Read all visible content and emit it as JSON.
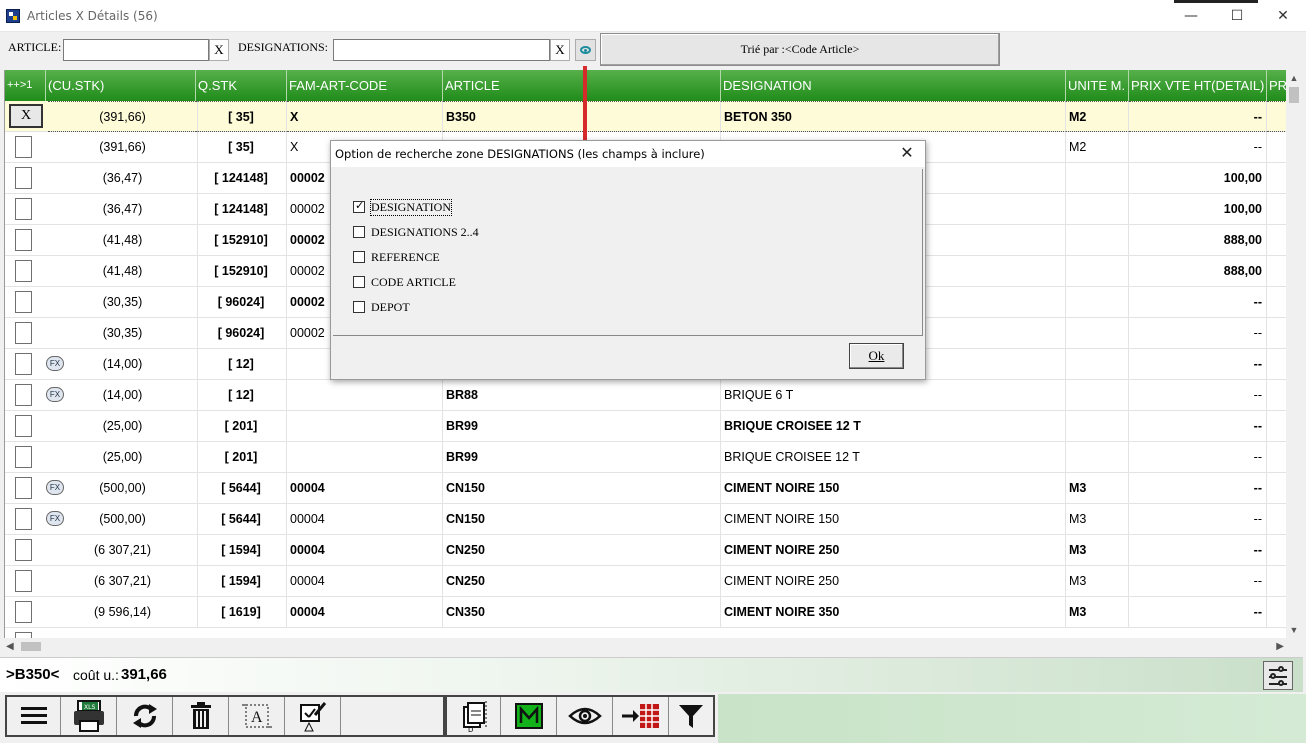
{
  "window": {
    "title": "Articles X Détails (56)"
  },
  "search": {
    "article_label": "ARTICLE:",
    "article_value": "",
    "article_clear": "X",
    "designations_label": "DESIGNATIONS:",
    "designations_value": "",
    "designations_clear": "X",
    "sort_label": "Trié par :<Code Article>"
  },
  "grid": {
    "headers": [
      "++>1",
      "(CU.STK)",
      "Q.STK",
      "FAM-ART-CODE",
      "ARTICLE",
      "DESIGNATION",
      "UNITE M.",
      "PRIX VTE HT(DETAIL)",
      "PR"
    ],
    "rows": [
      {
        "sel": "X",
        "fx": false,
        "cu": "(391,66)",
        "q": "[ 35]",
        "fam": "X",
        "art": "B350",
        "des": "BETON 350",
        "unit": "M2",
        "prix": "--",
        "b": true,
        "selected": true
      },
      {
        "sel": "",
        "fx": false,
        "cu": "(391,66)",
        "q": "[ 35]",
        "fam": "X",
        "art": "",
        "des": "",
        "unit": "M2",
        "prix": "--",
        "b": false
      },
      {
        "sel": "",
        "fx": false,
        "cu": "(36,47)",
        "q": "[ 124148]",
        "fam": "00002",
        "art": "",
        "des": "",
        "unit": "",
        "prix": "100,00",
        "b": true
      },
      {
        "sel": "",
        "fx": false,
        "cu": "(36,47)",
        "q": "[ 124148]",
        "fam": "00002",
        "art": "",
        "des": "",
        "unit": "",
        "prix": "100,00",
        "b": false,
        "pb": true
      },
      {
        "sel": "",
        "fx": false,
        "cu": "(41,48)",
        "q": "[ 152910]",
        "fam": "00002",
        "art": "",
        "des": "",
        "unit": "",
        "prix": "888,00",
        "b": true
      },
      {
        "sel": "",
        "fx": false,
        "cu": "(41,48)",
        "q": "[ 152910]",
        "fam": "00002",
        "art": "",
        "des": "",
        "unit": "",
        "prix": "888,00",
        "b": false,
        "pb": true
      },
      {
        "sel": "",
        "fx": false,
        "cu": "(30,35)",
        "q": "[ 96024]",
        "fam": "00002",
        "art": "",
        "des": "",
        "unit": "",
        "prix": "--",
        "b": true
      },
      {
        "sel": "",
        "fx": false,
        "cu": "(30,35)",
        "q": "[ 96024]",
        "fam": "00002",
        "art": "",
        "des": "",
        "unit": "",
        "prix": "--",
        "b": false
      },
      {
        "sel": "",
        "fx": true,
        "cu": "(14,00)",
        "q": "[ 12]",
        "fam": "",
        "art": "",
        "des": "",
        "unit": "",
        "prix": "--",
        "b": true
      },
      {
        "sel": "",
        "fx": true,
        "cu": "(14,00)",
        "q": "[ 12]",
        "fam": "",
        "art": "BR88",
        "des": "BRIQUE 6 T",
        "unit": "",
        "prix": "--",
        "b": false
      },
      {
        "sel": "",
        "fx": false,
        "cu": "(25,00)",
        "q": "[ 201]",
        "fam": "",
        "art": "BR99",
        "des": "BRIQUE CROISEE 12 T",
        "unit": "",
        "prix": "--",
        "b": true
      },
      {
        "sel": "",
        "fx": false,
        "cu": "(25,00)",
        "q": "[ 201]",
        "fam": "",
        "art": "BR99",
        "des": "BRIQUE CROISEE 12 T",
        "unit": "",
        "prix": "--",
        "b": false
      },
      {
        "sel": "",
        "fx": true,
        "cu": "(500,00)",
        "q": "[ 5644]",
        "fam": "00004",
        "art": "CN150",
        "des": "CIMENT NOIRE 150",
        "unit": "M3",
        "prix": "--",
        "b": true
      },
      {
        "sel": "",
        "fx": true,
        "cu": "(500,00)",
        "q": "[ 5644]",
        "fam": "00004",
        "art": "CN150",
        "des": "CIMENT NOIRE 150",
        "unit": "M3",
        "prix": "--",
        "b": false
      },
      {
        "sel": "",
        "fx": false,
        "cu": "(6 307,21)",
        "q": "[ 1594]",
        "fam": "00004",
        "art": "CN250",
        "des": "CIMENT NOIRE 250",
        "unit": "M3",
        "prix": "--",
        "b": true
      },
      {
        "sel": "",
        "fx": false,
        "cu": "(6 307,21)",
        "q": "[ 1594]",
        "fam": "00004",
        "art": "CN250",
        "des": "CIMENT NOIRE 250",
        "unit": "M3",
        "prix": "--",
        "b": false
      },
      {
        "sel": "",
        "fx": false,
        "cu": "(9 596,14)",
        "q": "[ 1619]",
        "fam": "00004",
        "art": "CN350",
        "des": "CIMENT NOIRE 350",
        "unit": "M3",
        "prix": "--",
        "b": true
      }
    ]
  },
  "status": {
    "ref": ">B350<",
    "label": "coût u.:",
    "value": "391,66"
  },
  "dialog": {
    "title": "Option de recherche zone DESIGNATIONS (les champs à inclure)",
    "close": "✕",
    "options": [
      {
        "label": "DESIGNATION",
        "checked": true
      },
      {
        "label": "DESIGNATIONS 2..4",
        "checked": false
      },
      {
        "label": "REFERENCE",
        "checked": false
      },
      {
        "label": "CODE ARTICLE",
        "checked": false
      },
      {
        "label": "DEPOT",
        "checked": false
      }
    ],
    "ok": "Ok"
  },
  "toolbar": {
    "icons": [
      "menu-icon",
      "excel-print-icon",
      "refresh-icon",
      "trash-icon",
      "text-select-icon",
      "edit-doc-icon",
      "blank",
      "doc-dropdown-icon",
      "m-icon",
      "eye-icon",
      "grid-arrow-icon",
      "filter-icon"
    ]
  },
  "colors": {
    "header_green": "#2e9a26",
    "selected_row": "#fdfbd8",
    "red_link": "#d52b2b"
  }
}
